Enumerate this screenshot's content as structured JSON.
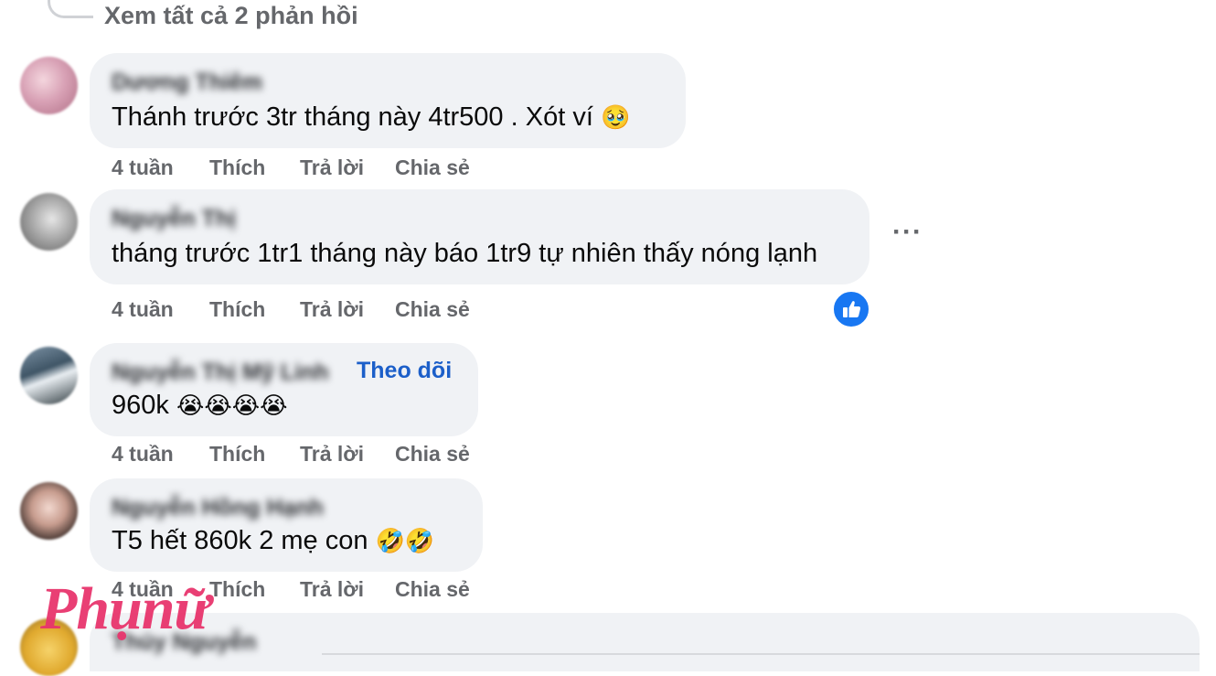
{
  "thread": {
    "view_replies_label": "Xem tất cả 2 phản hồi"
  },
  "comments": [
    {
      "author": "Dương Thiêm",
      "text": "Thánh trước 3tr tháng này 4tr500 . Xót ví",
      "emoji": "🥹",
      "time": "4 tuần",
      "like_label": "Thích",
      "reply_label": "Trả lời",
      "share_label": "Chia sẻ"
    },
    {
      "author": "Nguyễn Thị",
      "text": "tháng trước 1tr1 tháng này báo 1tr9 tự nhiên thấy nóng lạnh",
      "more_label": "···",
      "time": "4 tuần",
      "like_label": "Thích",
      "reply_label": "Trả lời",
      "share_label": "Chia sẻ"
    },
    {
      "author": "Nguyễn Thị Mỹ Linh",
      "follow_label": "Theo dõi",
      "text": "960k",
      "emoji": "😭😭😭😭",
      "time": "4 tuần",
      "like_label": "Thích",
      "reply_label": "Trả lời",
      "share_label": "Chia sẻ"
    },
    {
      "author": "Nguyễn Hồng Hạnh",
      "text": "T5 hết 860k 2 mẹ con",
      "emoji": "🤣🤣",
      "time": "4 tuần",
      "like_label": "Thích",
      "reply_label": "Trả lời",
      "share_label": "Chia sẻ"
    },
    {
      "author": "Thúy Nguyễn"
    }
  ],
  "watermark": "Phụnữ",
  "colors": {
    "bubble": "#f0f2f5",
    "meta_text": "#65676b",
    "link_blue": "#1c5fc9",
    "like_badge": "#1877f2",
    "watermark": "#e8356d"
  }
}
